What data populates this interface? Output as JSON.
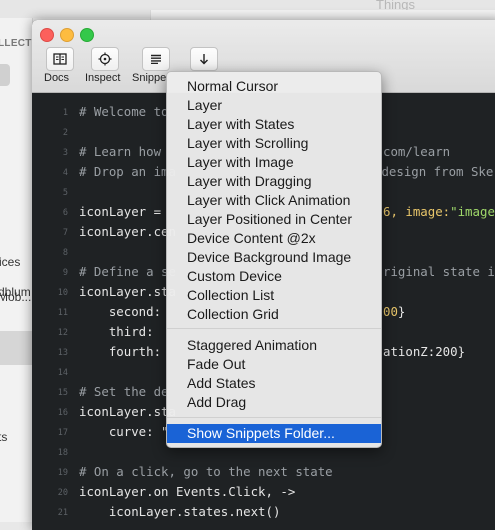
{
  "background_window": {
    "title": "Things",
    "sidebar_header": "LLECT",
    "sidebar_items": [
      "dblum",
      "ices",
      "Mob...",
      "ts"
    ]
  },
  "toolbar": {
    "buttons": [
      {
        "label": "Docs",
        "icon": "book-icon"
      },
      {
        "label": "Inspect",
        "icon": "crosshair-icon"
      },
      {
        "label": "Snippe",
        "icon": "list-icon"
      },
      {
        "label": "",
        "icon": "arrow-down-icon"
      }
    ]
  },
  "editor": {
    "lines": [
      {
        "n": "1",
        "text": "# Welcome to"
      },
      {
        "n": "2",
        "text": ""
      },
      {
        "n": "3",
        "text": "# Learn how"
      },
      {
        "n": "4",
        "text": "# Drop an ima"
      },
      {
        "n": "5",
        "text": ""
      },
      {
        "n": "6",
        "text": "iconLayer = "
      },
      {
        "n": "7",
        "text": "iconLayer.cen"
      },
      {
        "n": "8",
        "text": ""
      },
      {
        "n": "9",
        "text": "# Define a se"
      },
      {
        "n": "10",
        "text": "iconLayer.sta"
      },
      {
        "n": "11",
        "text": "    second: "
      },
      {
        "n": "12",
        "text": "    third:  "
      },
      {
        "n": "13",
        "text": "    fourth: "
      },
      {
        "n": "14",
        "text": ""
      },
      {
        "n": "15",
        "text": "# Set the de"
      },
      {
        "n": "16",
        "text": "iconLayer.sta"
      },
      {
        "n": "17",
        "text": "    curve: \""
      },
      {
        "n": "18",
        "text": ""
      },
      {
        "n": "19",
        "text": "# On a click, go to the next state"
      },
      {
        "n": "20",
        "text": "iconLayer.on Events.Click, ->"
      },
      {
        "n": "21",
        "text": "    iconLayer.states.next()"
      }
    ],
    "right_fragments": {
      "line3": "com/learn",
      "line4": " design from Ske",
      "line6a": "6, image:",
      "line6b": "\"images",
      "line9": "riginal state is",
      "line11a": "00",
      "line11b": "}",
      "line13": "ationZ:200}"
    }
  },
  "menu": {
    "group1": [
      "Normal Cursor",
      "Layer",
      "Layer with States",
      "Layer with Scrolling",
      "Layer with Image",
      "Layer with Dragging",
      "Layer with Click Animation",
      "Layer Positioned in Center",
      "Device Content @2x",
      "Device Background Image",
      "Custom Device",
      "Collection List",
      "Collection Grid"
    ],
    "group2": [
      "Staggered Animation",
      "Fade Out",
      "Add States",
      "Add Drag"
    ],
    "group3": [
      "Show Snippets Folder..."
    ],
    "selected": "Show Snippets Folder..."
  },
  "colors": {
    "selection": "#1a63d6",
    "editor_bg": "#1f2224",
    "string": "#9fd86a",
    "number": "#e8c66a"
  }
}
